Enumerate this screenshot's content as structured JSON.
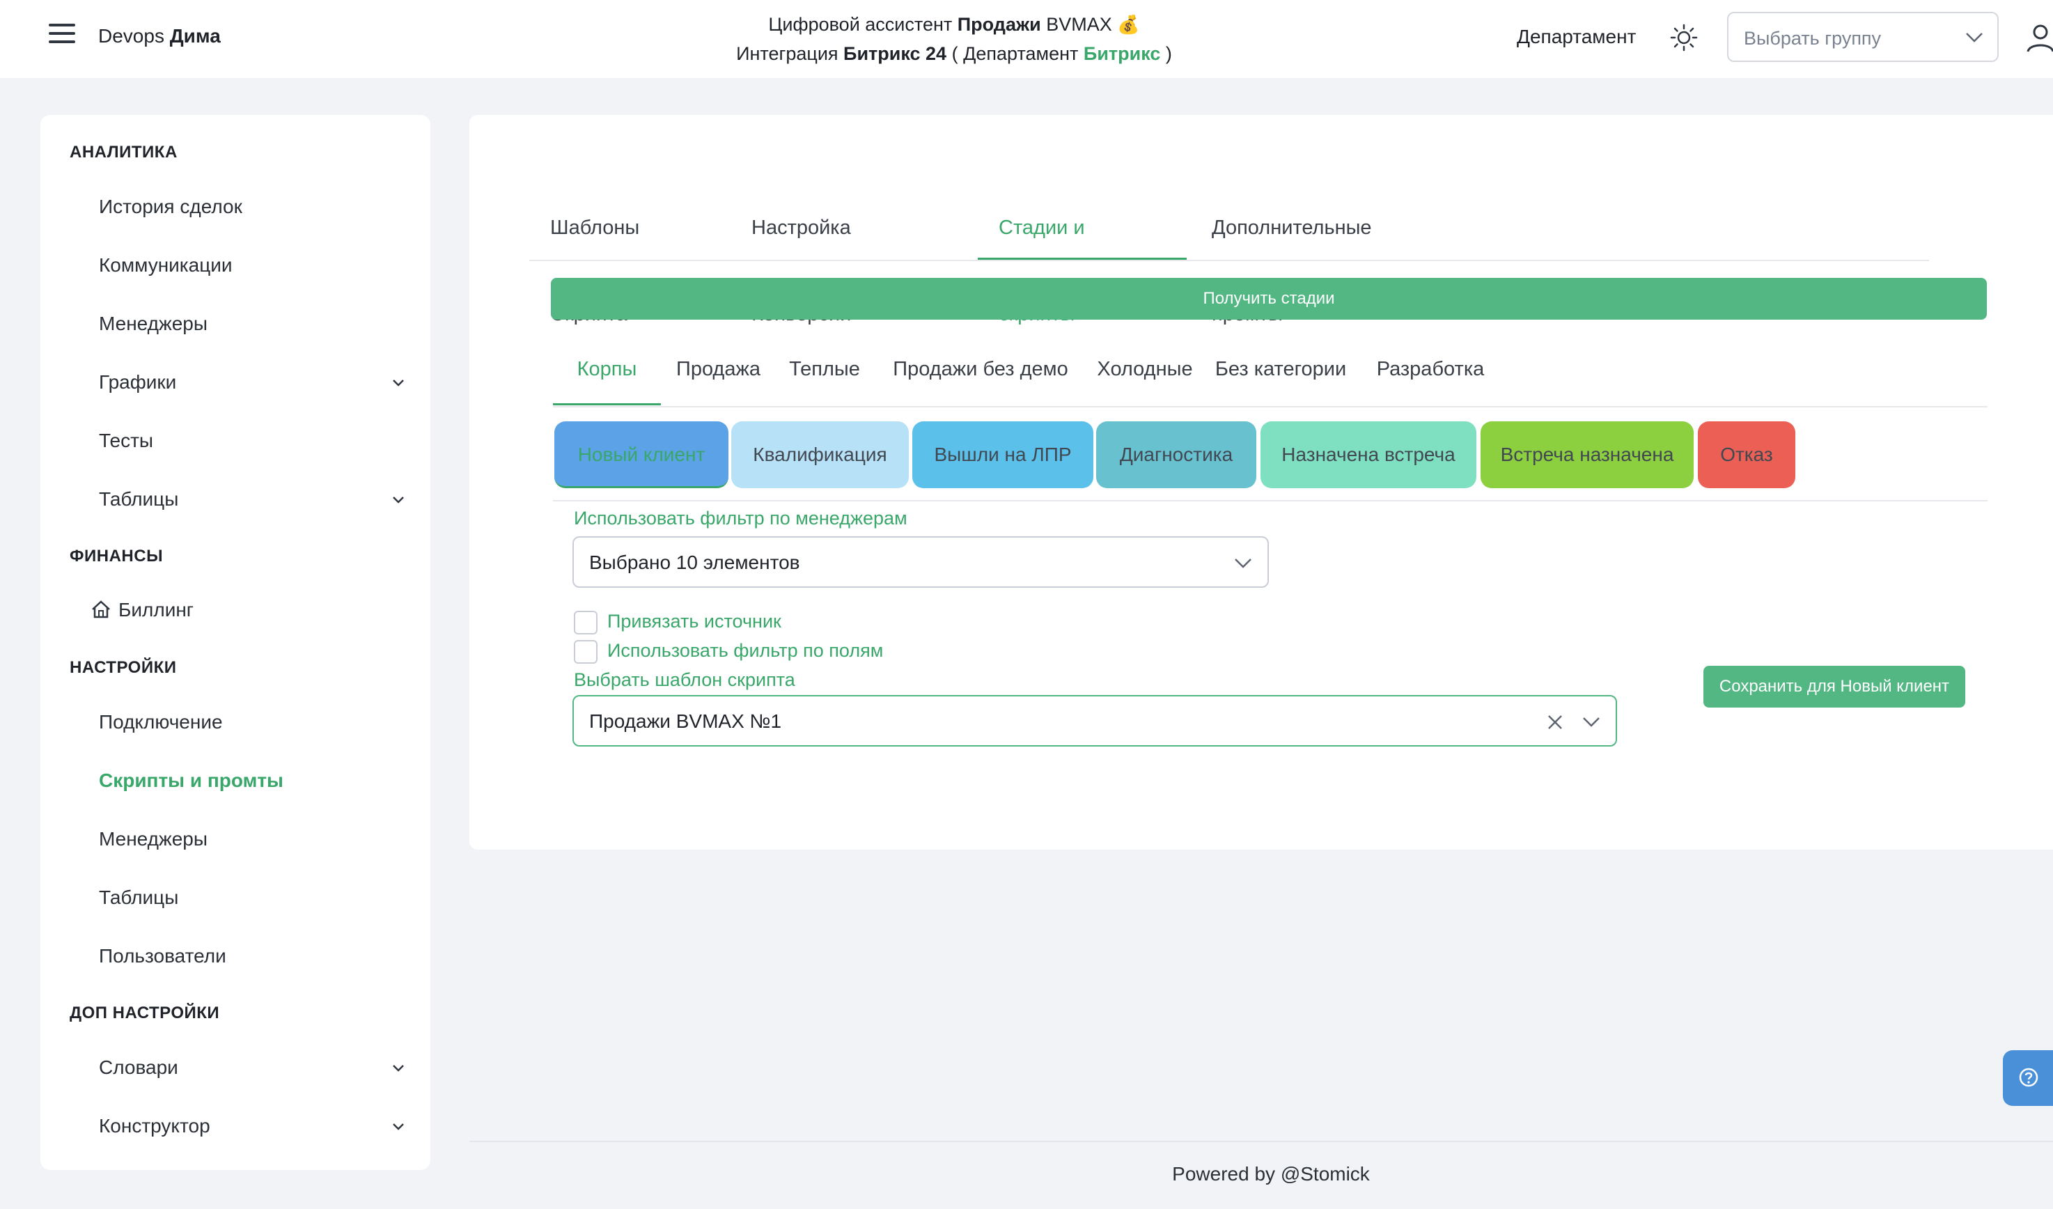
{
  "header": {
    "user_prefix": "Devops",
    "user_name": "Дима",
    "title_line1_prefix": "Цифровой ассистент",
    "title_line1_bold": "Продажи",
    "title_line1_suffix": "BVMAX",
    "title_line2_prefix": "Интеграция",
    "title_line2_bold": "Битрикс 24",
    "title_line2_dept_prefix": "( Департамент",
    "title_line2_dept": "Битрикс",
    "title_line2_close": ")",
    "department_label": "Департамент",
    "group_placeholder": "Выбрать группу"
  },
  "sidebar": {
    "sections": [
      {
        "title": "АНАЛИТИКА"
      },
      {
        "title": "ФИНАНСЫ"
      },
      {
        "title": "НАСТРОЙКИ"
      },
      {
        "title": "ДОП НАСТРОЙКИ"
      }
    ],
    "items": [
      {
        "label": "История сделок"
      },
      {
        "label": "Коммуникации"
      },
      {
        "label": "Менеджеры"
      },
      {
        "label": "Графики"
      },
      {
        "label": "Тесты"
      },
      {
        "label": "Таблицы"
      },
      {
        "label": "Биллинг"
      },
      {
        "label": "Подключение"
      },
      {
        "label": "Скрипты и промты"
      },
      {
        "label": "Менеджеры"
      },
      {
        "label": "Таблицы"
      },
      {
        "label": "Пользователи"
      },
      {
        "label": "Словари"
      },
      {
        "label": "Конструктор"
      }
    ]
  },
  "main": {
    "tabs": [
      {
        "label": "Шаблоны Скрипта"
      },
      {
        "label": "Настройка Конверсии"
      },
      {
        "label": "Стадии и скрипты"
      },
      {
        "label": "Дополнительные промты"
      }
    ],
    "get_stages_label": "Получить стадии",
    "categories": [
      {
        "label": "Корпы"
      },
      {
        "label": "Продажа"
      },
      {
        "label": "Теплые"
      },
      {
        "label": "Продажи без демо"
      },
      {
        "label": "Холодные"
      },
      {
        "label": "Без категории"
      },
      {
        "label": "Разработка"
      }
    ],
    "stages": [
      {
        "label": "Новый клиент",
        "color": "#5ba3e6",
        "text_color": "#3aa76a"
      },
      {
        "label": "Квалификация",
        "color": "#b7e1f6",
        "text_color": "#414852"
      },
      {
        "label": "Вышли на ЛПР",
        "color": "#5bc0ea",
        "text_color": "#414852"
      },
      {
        "label": "Диагностика",
        "color": "#67c1cf",
        "text_color": "#414852"
      },
      {
        "label": "Назначена встреча",
        "color": "#7ee0c1",
        "text_color": "#414852"
      },
      {
        "label": "Встреча назначена",
        "color": "#8ccf3f",
        "text_color": "#414852"
      },
      {
        "label": "Отказ",
        "color": "#ec5f55",
        "text_color": "#414852"
      }
    ],
    "manager_filter_label": "Использовать фильтр по менеджерам",
    "manager_filter_value": "Выбрано 10 элементов",
    "bind_source_label": "Привязать источник",
    "field_filter_label": "Использовать фильтр по полям",
    "script_template_label": "Выбрать шаблон скрипта",
    "script_template_value": "Продажи BVMAX №1",
    "save_label": "Сохранить для Новый клиент"
  },
  "footer": {
    "text": "Powered by @Stomick"
  },
  "colors": {
    "accent": "#3aa76a",
    "button": "#53b784",
    "help": "#4a90d9"
  }
}
